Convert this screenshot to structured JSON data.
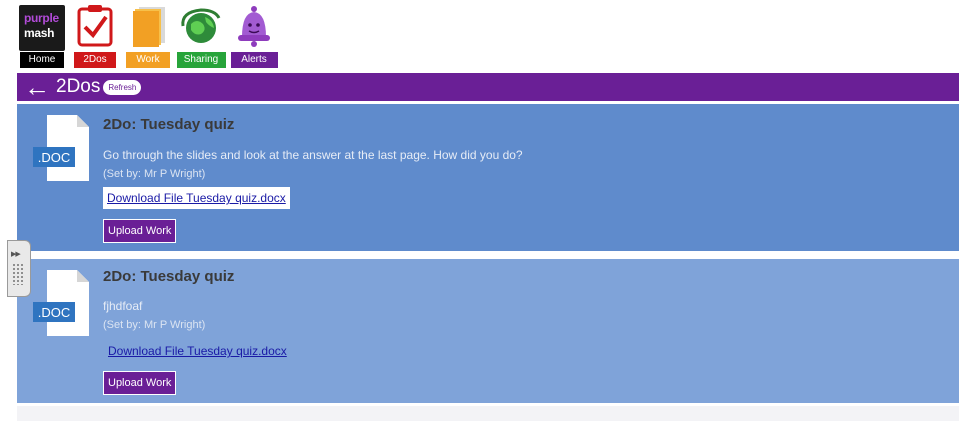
{
  "nav": {
    "logo": {
      "line1": "purple",
      "line2": "mash"
    },
    "items": [
      {
        "label": "Home",
        "icon": "home-logo-icon",
        "color": "#000000"
      },
      {
        "label": "2Dos",
        "icon": "checklist-icon",
        "color": "#d0181a"
      },
      {
        "label": "Work",
        "icon": "folder-icon",
        "color": "#f2a024"
      },
      {
        "label": "Sharing",
        "icon": "globe-icon",
        "color": "#27a43a"
      },
      {
        "label": "Alerts",
        "icon": "bell-icon",
        "color": "#6a1f96"
      }
    ]
  },
  "titlebar": {
    "title": "2Dos",
    "refresh": "Refresh",
    "color": "#6a1f96"
  },
  "todos": [
    {
      "doc_label": ".DOC",
      "title": "2Do: Tuesday quiz",
      "description": "Go through the slides and look at the answer at the last page. How did you do?",
      "set_by": "(Set by: Mr P Wright)",
      "download": "Download File Tuesday quiz.docx",
      "upload": "Upload Work",
      "color": "#5f8bcc"
    },
    {
      "doc_label": ".DOC",
      "title": "2Do: Tuesday quiz",
      "description": "fjhdfoaf",
      "set_by": "(Set by: Mr P Wright)",
      "download": "Download File Tuesday quiz.docx",
      "upload": "Upload Work",
      "color": "#7fa3d9"
    }
  ]
}
